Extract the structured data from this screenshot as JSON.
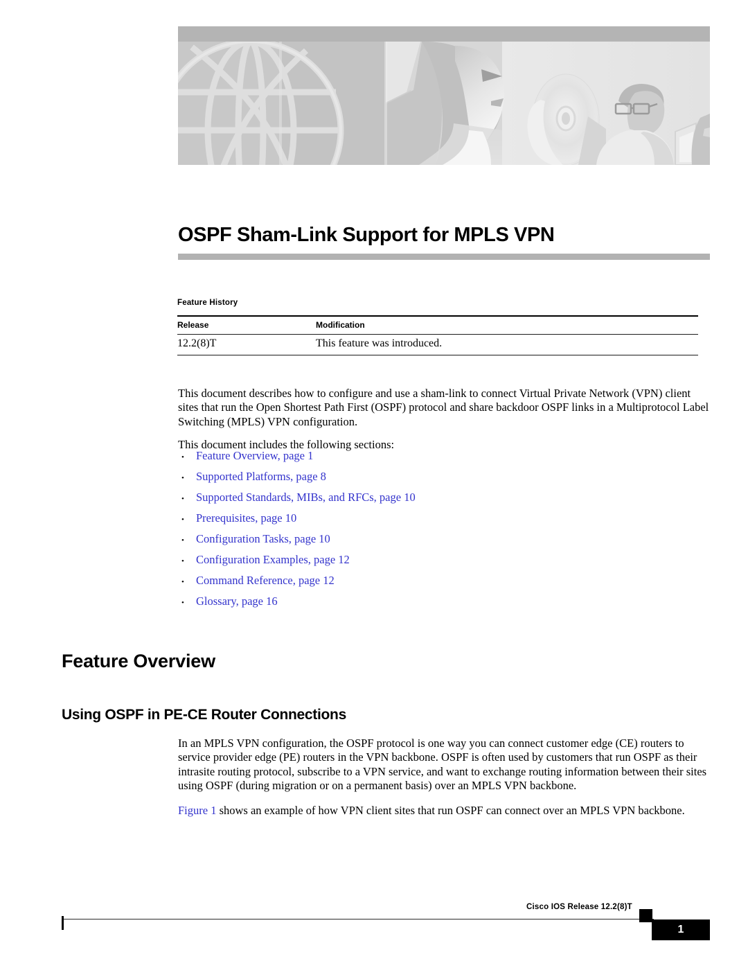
{
  "header": {
    "banner_alt": "cisco-documentation-banner-grayscale",
    "banner_elements": [
      "globe-wireframe",
      "woman-profile",
      "compact-disc",
      "person-at-monitor",
      "second-person-at-monitor"
    ]
  },
  "document": {
    "title": "OSPF Sham-Link Support for MPLS VPN"
  },
  "feature_history": {
    "label": "Feature History",
    "columns": [
      "Release",
      "Modification"
    ],
    "rows": [
      {
        "release": "12.2(8)T",
        "modification": "This feature was introduced."
      }
    ]
  },
  "body": {
    "intro": "This document describes how to configure and use a sham-link to connect Virtual Private Network (VPN) client sites that run the Open Shortest Path First (OSPF) protocol and share backdoor OSPF links in a Multiprotocol Label Switching (MPLS) VPN configuration.",
    "includes": "This document includes the following sections:"
  },
  "section_links": [
    {
      "bullet": "•",
      "label": "Feature Overview, page 1"
    },
    {
      "bullet": "•",
      "label": "Supported Platforms, page 8"
    },
    {
      "bullet": "•",
      "label": "Supported Standards, MIBs, and RFCs, page 10"
    },
    {
      "bullet": "•",
      "label": "Prerequisites, page 10"
    },
    {
      "bullet": "•",
      "label": "Configuration Tasks, page 10"
    },
    {
      "bullet": "•",
      "label": "Configuration Examples, page 12"
    },
    {
      "bullet": "•",
      "label": "Command Reference, page 12"
    },
    {
      "bullet": "•",
      "label": "Glossary, page 16"
    }
  ],
  "sections": {
    "feature_overview_heading": "Feature Overview",
    "using_ospf_heading": "Using OSPF in PE-CE Router Connections",
    "using_ospf_para": "In an MPLS VPN configuration, the OSPF protocol is one way you can connect customer edge (CE) routers to service provider edge (PE) routers in the VPN backbone. OSPF is often used by customers that run OSPF as their intrasite routing protocol, subscribe to a VPN service, and want to exchange routing information between their sites using OSPF (during migration or on a permanent basis) over an MPLS VPN backbone.",
    "figure_link": "Figure 1",
    "figure_para_rest": " shows an example of how VPN client sites that run OSPF can connect over an MPLS VPN backbone."
  },
  "footer": {
    "release_text": "Cisco IOS Release 12.2(8)T",
    "page_number": "1"
  },
  "colors": {
    "link": "#3333cc",
    "title_rule": "#b2b2b2",
    "banner_strip": "#b4b4b4",
    "footer_box": "#000000"
  }
}
